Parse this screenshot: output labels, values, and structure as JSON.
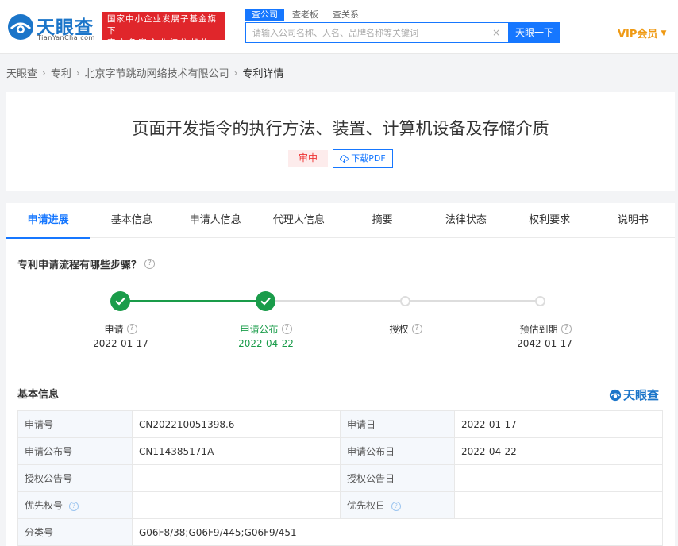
{
  "header": {
    "logo_text": "天眼查",
    "logo_sub": "TianYanCha.com",
    "banner_line1": "国家中小企业发展子基金旗下",
    "banner_line2": "官方备案企业征信机构",
    "search_tabs": [
      {
        "label": "查公司",
        "active": true
      },
      {
        "label": "查老板",
        "active": false
      },
      {
        "label": "查关系",
        "active": false
      }
    ],
    "search_placeholder": "请输入公司名称、人名、品牌名称等关键词",
    "search_value": "",
    "clear_icon": "×",
    "search_button": "天眼一下",
    "vip_label": "VIP会员",
    "colors": {
      "brand": "#1b75c9",
      "accent": "#1677ff",
      "banner": "#e0262b",
      "vip": "#ef9a14"
    }
  },
  "breadcrumb": {
    "items": [
      "天眼查",
      "专利",
      "北京字节跳动网络技术有限公司",
      "专利详情"
    ],
    "separator": "›"
  },
  "patent": {
    "title": "页面开发指令的执行方法、装置、计算机设备及存储介质",
    "status": "审中",
    "pdf_button": "下载PDF"
  },
  "tabs": [
    {
      "label": "申请进展",
      "active": true
    },
    {
      "label": "基本信息",
      "active": false
    },
    {
      "label": "申请人信息",
      "active": false
    },
    {
      "label": "代理人信息",
      "active": false
    },
    {
      "label": "摘要",
      "active": false
    },
    {
      "label": "法律状态",
      "active": false
    },
    {
      "label": "权利要求",
      "active": false
    },
    {
      "label": "说明书",
      "active": false
    }
  ],
  "progress": {
    "heading": "专利申请流程有哪些步骤？",
    "steps": [
      {
        "label": "申请",
        "date": "2022-01-17",
        "done": true,
        "current": false
      },
      {
        "label": "申请公布",
        "date": "2022-04-22",
        "done": true,
        "current": true
      },
      {
        "label": "授权",
        "date": "-",
        "done": false,
        "current": false
      },
      {
        "label": "预估到期",
        "date": "2042-01-17",
        "done": false,
        "current": false
      }
    ],
    "colors": {
      "done": "#1a9c4a",
      "todo": "#dddddd"
    }
  },
  "basic_info": {
    "heading": "基本信息",
    "brand_mark": "天眼查",
    "rows": [
      {
        "k1": "申请号",
        "v1": "CN202210051398.6",
        "k2": "申请日",
        "v2": "2022-01-17"
      },
      {
        "k1": "申请公布号",
        "v1": "CN114385171A",
        "k2": "申请公布日",
        "v2": "2022-04-22"
      },
      {
        "k1": "授权公告号",
        "v1": "-",
        "k2": "授权公告日",
        "v2": "-"
      },
      {
        "k1": "优先权号",
        "v1": "-",
        "k2": "优先权日",
        "v2": "-"
      },
      {
        "k1": "分类号",
        "v1": "G06F8/38;G06F9/445;G06F9/451"
      }
    ]
  }
}
